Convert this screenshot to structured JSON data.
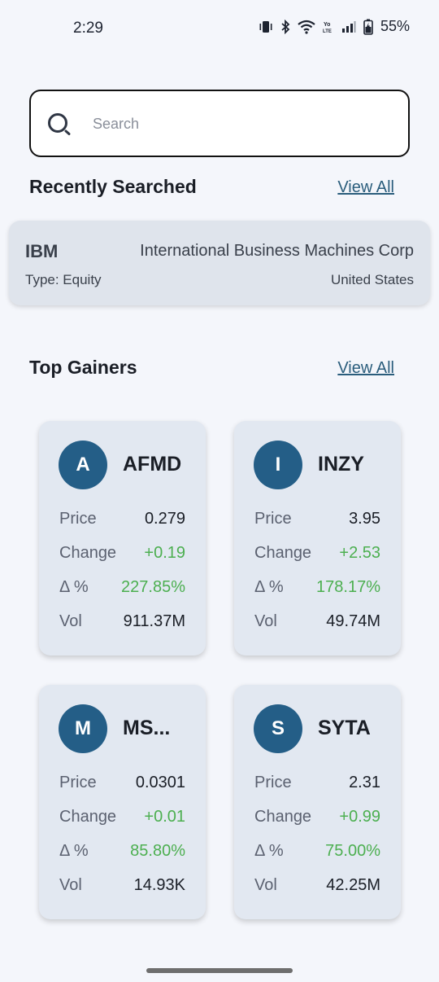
{
  "status_bar": {
    "time": "2:29",
    "battery": "55%",
    "icons": [
      "vibrate-icon",
      "bluetooth-icon",
      "wifi-icon",
      "volte-icon",
      "signal-icon",
      "battery-icon"
    ]
  },
  "search": {
    "placeholder": "Search",
    "value": ""
  },
  "recent": {
    "title": "Recently Searched",
    "view_all": "View All",
    "item": {
      "symbol": "IBM",
      "name": "International Business Machines Corp",
      "type": "Type: Equity",
      "country": "United States"
    }
  },
  "top_gainers": {
    "title": "Top Gainers",
    "view_all": "View All",
    "labels": {
      "price": "Price",
      "change": "Change",
      "pct": "Δ %",
      "vol": "Vol"
    },
    "cards": [
      {
        "initial": "A",
        "ticker": "AFMD",
        "price": "0.279",
        "change": "+0.19",
        "pct": "227.85%",
        "vol": "911.37M"
      },
      {
        "initial": "I",
        "ticker": "INZY",
        "price": "3.95",
        "change": "+2.53",
        "pct": "178.17%",
        "vol": "49.74M"
      },
      {
        "initial": "M",
        "ticker": "MS...",
        "price": "0.0301",
        "change": "+0.01",
        "pct": "85.80%",
        "vol": "14.93K"
      },
      {
        "initial": "S",
        "ticker": "SYTA",
        "price": "2.31",
        "change": "+0.99",
        "pct": "75.00%",
        "vol": "42.25M"
      }
    ]
  },
  "colors": {
    "background": "#f4f6fb",
    "card": "#e2e8f1",
    "avatar": "#245e87",
    "link": "#2a5d7c",
    "positive": "#4caf50"
  }
}
